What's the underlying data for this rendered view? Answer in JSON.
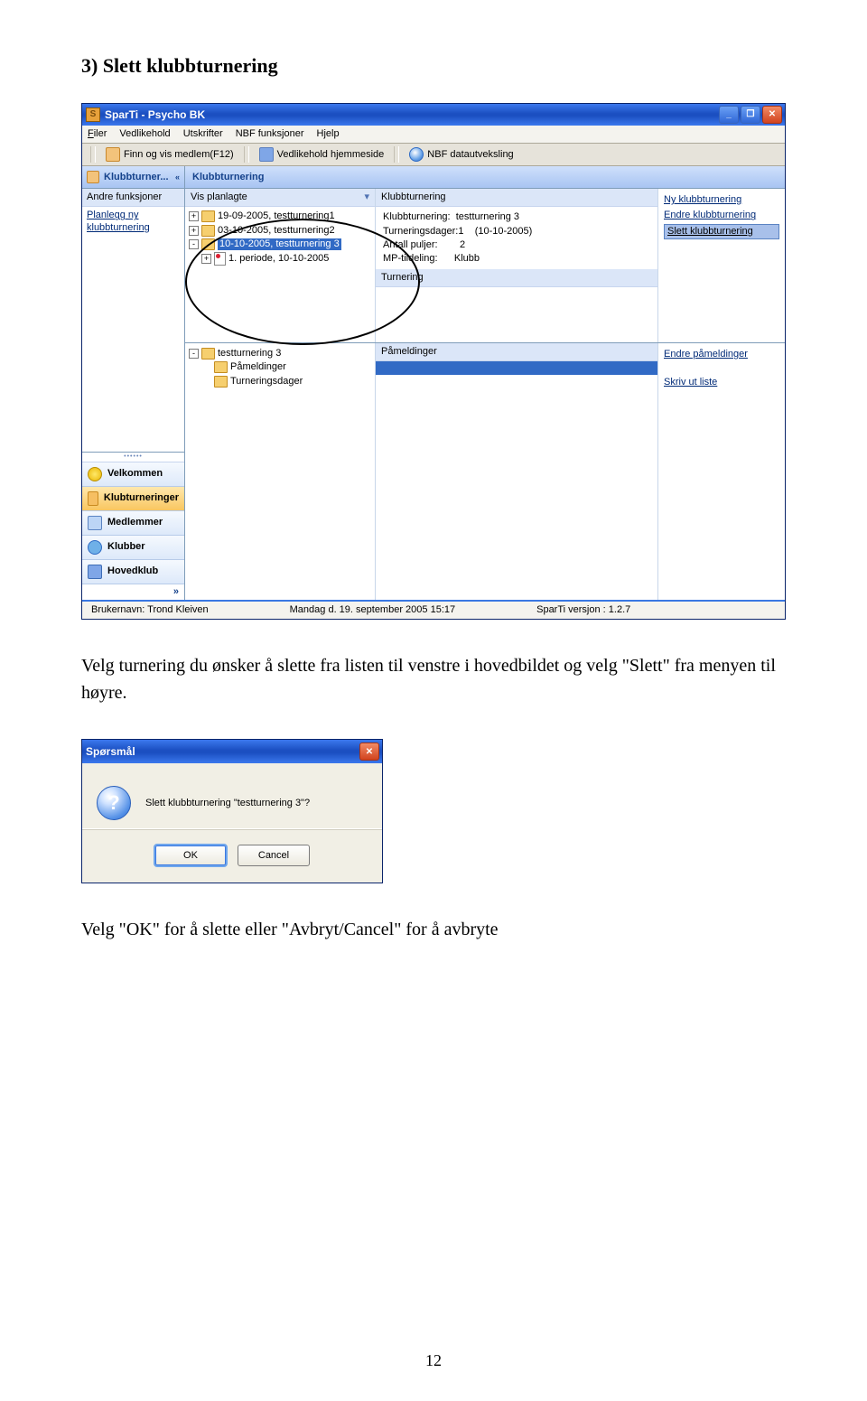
{
  "heading": "3) Slett klubbturnering",
  "text1": "Velg turnering du ønsker å slette fra listen til venstre i hovedbildet og velg \"Slett\" fra menyen til høyre.",
  "text2": "Velg \"OK\" for å slette eller \"Avbryt/Cancel\" for å avbryte",
  "page_number": "12",
  "app": {
    "title": "SparTi - Psycho BK",
    "menus": [
      "Filer",
      "Vedlikehold",
      "Utskrifter",
      "NBF funksjoner",
      "Hjelp"
    ],
    "toolbar": {
      "find_member": "Finn og vis medlem(F12)",
      "maintain_home": "Vedlikehold hjemmeside",
      "nbf_exchange": "NBF datautveksling"
    },
    "sidebar": {
      "header": "Klubbturner...",
      "section_label": "Andre funksjoner",
      "plan_link": "Planlegg ny klubbturnering",
      "nav": {
        "welcome": "Velkommen",
        "tournaments": "Klubturneringer",
        "members": "Medlemmer",
        "clubs": "Klubber",
        "hovedklub": "Hovedklub"
      },
      "footer_chevrons": "»"
    },
    "main": {
      "tab_title": "Klubbturnering",
      "upper": {
        "tree_strip": "Vis planlagte",
        "tree": {
          "item1": "19-09-2005, testturnering1",
          "item2": "03-10-2005, testturnering2",
          "item3": "10-10-2005, testturnering 3",
          "item3b": "1. periode, 10-10-2005"
        },
        "detail_strip": "Klubbturnering",
        "kv": {
          "l1a": "Klubbturnering:",
          "l1b": "testturnering 3",
          "l2a": "Turneringsdager:1",
          "l2b": "(10-10-2005)",
          "l3a": "Antall puljer:",
          "l3b": "2",
          "l4a": "MP-tildeling:",
          "l4b": "Klubb"
        },
        "detail_strip2": "Turnering",
        "links": {
          "new": "Ny klubbturnering",
          "edit": "Endre klubbturnering",
          "del": "Slett klubbturnering"
        }
      },
      "lower": {
        "tree_root": "testturnering 3",
        "tree_c1": "Påmeldinger",
        "tree_c2": "Turneringsdager",
        "list_strip": "Påmeldinger",
        "links": {
          "edit": "Endre påmeldinger",
          "print": "Skriv ut liste"
        }
      }
    },
    "status": {
      "user": "Brukernavn: Trond Kleiven",
      "date": "Mandag d. 19. september 2005 15:17",
      "ver": "SparTi versjon : 1.2.7"
    }
  },
  "dialog": {
    "title": "Spørsmål",
    "msg": "Slett klubbturnering \"testturnering 3\"?",
    "ok": "OK",
    "cancel": "Cancel"
  }
}
